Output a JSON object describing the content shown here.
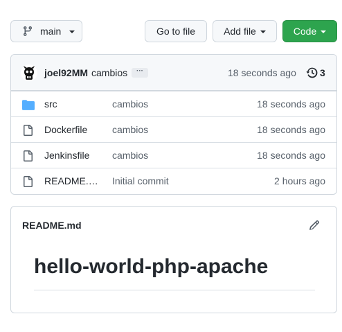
{
  "toolbar": {
    "branch_label": "main",
    "goto_file_label": "Go to file",
    "add_file_label": "Add file",
    "code_label": "Code",
    "code_button_color": "#2da44e"
  },
  "latest_commit": {
    "author": "joel92MM",
    "message": "cambios",
    "ellipsis": "···",
    "time": "18 seconds ago",
    "commit_count": "3"
  },
  "files": [
    {
      "name": "src",
      "type": "folder",
      "message": "cambios",
      "time": "18 seconds ago"
    },
    {
      "name": "Dockerfile",
      "type": "file",
      "message": "cambios",
      "time": "18 seconds ago"
    },
    {
      "name": "Jenkinsfile",
      "type": "file",
      "message": "cambios",
      "time": "18 seconds ago"
    },
    {
      "name": "README.…",
      "type": "file",
      "message": "Initial commit",
      "time": "2 hours ago"
    }
  ],
  "readme": {
    "title": "README.md",
    "heading": "hello-world-php-apache"
  }
}
